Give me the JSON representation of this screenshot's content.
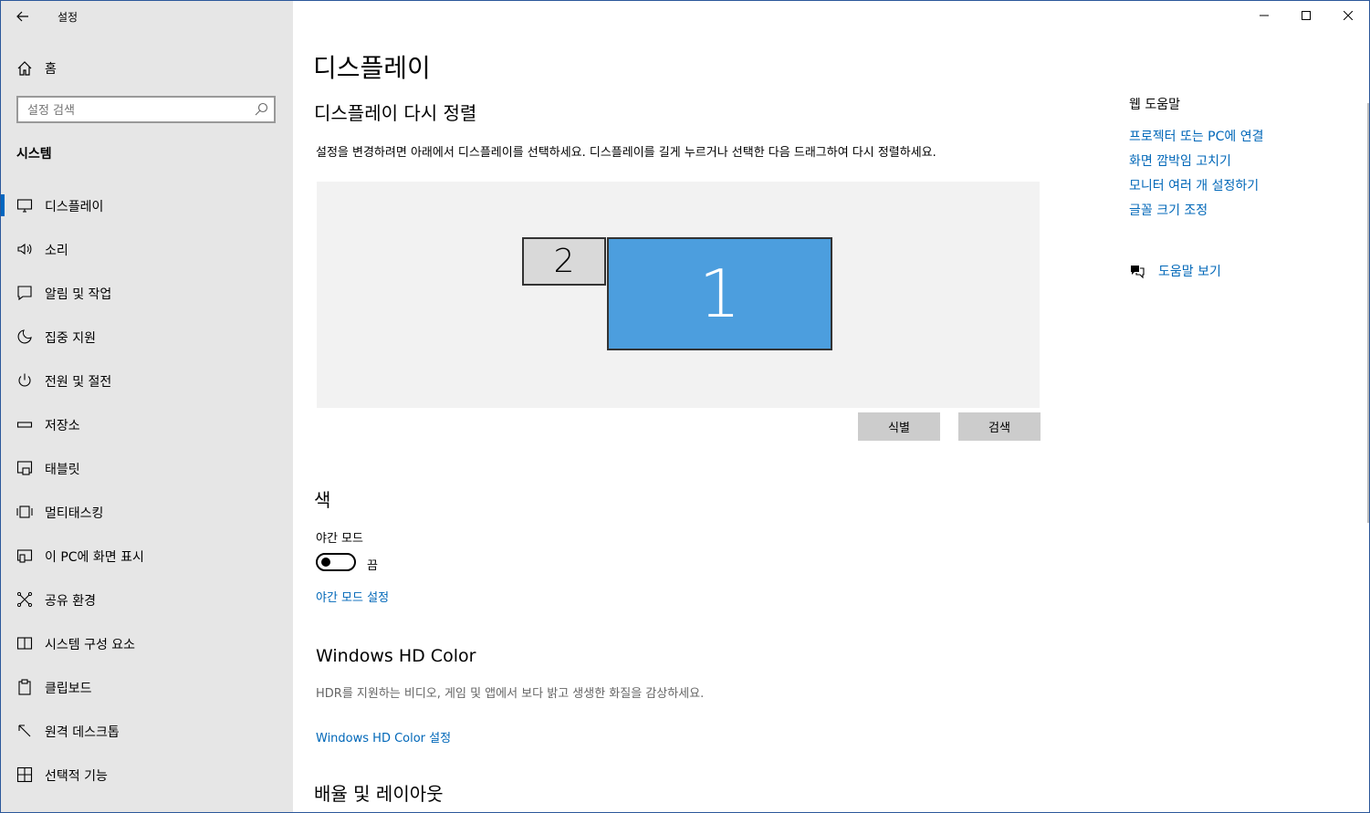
{
  "app": {
    "title": "설정",
    "back_icon": "arrow-left-icon"
  },
  "sidebar": {
    "home_label": "홈",
    "search_placeholder": "설정 검색",
    "section_label": "시스템",
    "items": [
      {
        "label": "디스플레이",
        "icon": "monitor-icon",
        "selected": true
      },
      {
        "label": "소리",
        "icon": "speaker-icon"
      },
      {
        "label": "알림 및 작업",
        "icon": "notification-icon"
      },
      {
        "label": "집중 지원",
        "icon": "moon-icon"
      },
      {
        "label": "전원 및 절전",
        "icon": "power-icon"
      },
      {
        "label": "저장소",
        "icon": "storage-icon"
      },
      {
        "label": "태블릿",
        "icon": "tablet-icon"
      },
      {
        "label": "멀티태스킹",
        "icon": "multitasking-icon"
      },
      {
        "label": "이 PC에 화면 표시",
        "icon": "project-icon"
      },
      {
        "label": "공유 환경",
        "icon": "shared-experiences-icon"
      },
      {
        "label": "시스템 구성 요소",
        "icon": "system-components-icon"
      },
      {
        "label": "클립보드",
        "icon": "clipboard-icon"
      },
      {
        "label": "원격 데스크톱",
        "icon": "remote-desktop-icon"
      },
      {
        "label": "선택적 기능",
        "icon": "optional-features-icon"
      }
    ]
  },
  "main": {
    "title": "디스플레이",
    "rearrange": {
      "heading": "디스플레이 다시 정렬",
      "description": "설정을 변경하려면 아래에서 디스플레이를 선택하세요. 디스플레이를 길게 누르거나 선택한 다음 드래그하여 다시 정렬하세요.",
      "monitors": [
        {
          "number": "1",
          "selected": true
        },
        {
          "number": "2",
          "selected": false
        }
      ],
      "identify_button": "식별",
      "detect_button": "검색"
    },
    "color": {
      "heading": "색",
      "night_mode_label": "야간 모드",
      "night_mode_state": "끔",
      "night_mode_settings_link": "야간 모드 설정"
    },
    "hd_color": {
      "heading": "Windows HD Color",
      "description": "HDR를 지원하는 비디오, 게임 및 앱에서 보다 밝고 생생한 화질을 감상하세요.",
      "settings_link": "Windows HD Color 설정"
    },
    "scale_heading": "배율 및 레이아웃"
  },
  "help": {
    "title": "웹 도움말",
    "links": [
      "프로젝터 또는 PC에 연결",
      "화면 깜박임 고치기",
      "모니터 여러 개 설정하기",
      "글꼴 크기 조정"
    ],
    "get_help": "도움말 보기"
  },
  "colors": {
    "accent": "#0067b8",
    "selected_monitor": "#4c9ede",
    "sidebar_bg": "#e6e6e6"
  }
}
